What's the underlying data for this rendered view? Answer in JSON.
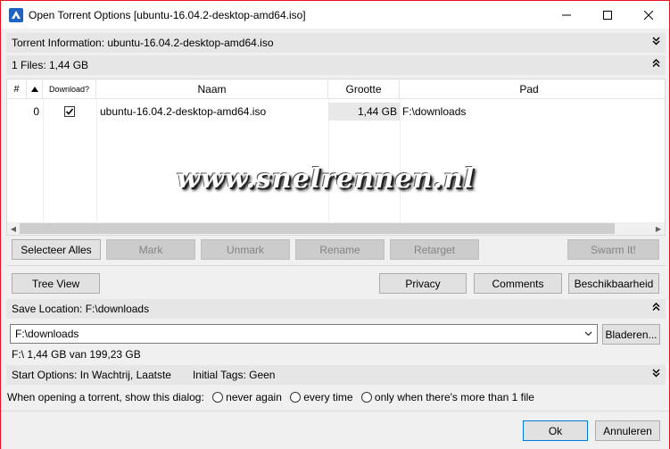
{
  "window": {
    "title": "Open Torrent Options [ubuntu-16.04.2-desktop-amd64.iso]",
    "accent": "#e81123"
  },
  "torrent_info": {
    "label": "Torrent Information: ubuntu-16.04.2-desktop-amd64.iso",
    "icon": "double-chevron-down-icon"
  },
  "files_section": {
    "label": "1 Files: 1,44 GB",
    "icon": "double-chevron-up-icon"
  },
  "table": {
    "columns": [
      "#",
      "Download?",
      "Naam",
      "Grootte",
      "Pad"
    ],
    "rows": [
      {
        "index": "0",
        "download": true,
        "name": "ubuntu-16.04.2-desktop-amd64.iso",
        "size": "1,44 GB",
        "path": "F:\\downloads"
      }
    ]
  },
  "watermark": "www.snelrennen.nl",
  "file_buttons": {
    "select_all": "Selecteer Alles",
    "mark": "Mark",
    "unmark": "Unmark",
    "rename": "Rename",
    "retarget": "Retarget",
    "swarm": "Swarm It!"
  },
  "view_buttons": {
    "tree_view": "Tree View",
    "privacy": "Privacy",
    "comments": "Comments",
    "availability": "Beschikbaarheid"
  },
  "save_location": {
    "label": "Save Location: F:\\downloads",
    "value": "F:\\downloads",
    "browse": "Bladeren...",
    "space_info": "F:\\  1,44 GB van 199,23 GB"
  },
  "start_options": {
    "label": "Start Options: In Wachtrij, Laatste",
    "tags": "Initial Tags: Geen"
  },
  "show_dialog": {
    "label": "When opening a torrent, show this dialog:",
    "options": [
      "never again",
      "every time",
      "only when there's more than 1 file"
    ]
  },
  "footer": {
    "ok": "Ok",
    "cancel": "Annuleren"
  }
}
